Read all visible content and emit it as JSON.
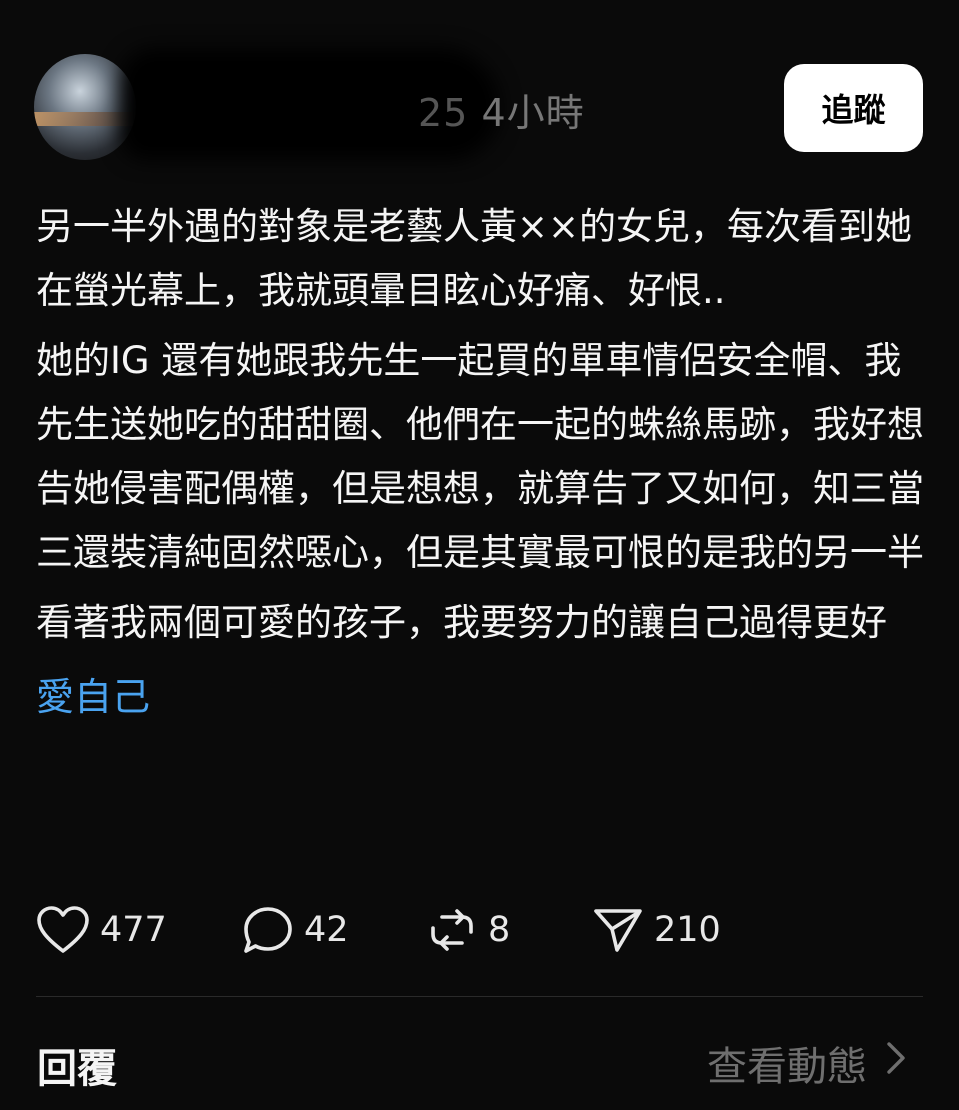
{
  "post": {
    "author_visible_fragment": "25",
    "time_ago": "4小時",
    "follow_label": "追蹤",
    "paragraphs": [
      "另一半外遇的對象是老藝人黃××的女兒，每次看到她在螢光幕上，我就頭暈目眩心好痛、好恨..",
      "她的IG 還有她跟我先生一起買的單車情侶安全帽、我先生送她吃的甜甜圈、他們在一起的蛛絲馬跡，我好想告她侵害配偶權，但是想想，就算告了又如何，知三當三還裝清純固然噁心，但是其實最可恨的是我的另一半",
      "看著我兩個可愛的孩子，我要努力的讓自己過得更好"
    ],
    "hashtag": "愛自己"
  },
  "actions": {
    "likes": "477",
    "comments": "42",
    "reposts": "8",
    "shares": "210"
  },
  "footer": {
    "reply_label": "回覆",
    "view_activity_label": "查看動態"
  },
  "icons": {
    "like": "heart-icon",
    "comment": "speech-bubble-icon",
    "repost": "repost-arrows-icon",
    "share": "paper-plane-icon",
    "chevron": "chevron-right-icon"
  },
  "colors": {
    "background": "#0a0a0a",
    "text": "#f5f5f5",
    "hashtag": "#4aa3f0",
    "muted": "#6f6f6f",
    "follow_button_bg": "#ffffff"
  }
}
